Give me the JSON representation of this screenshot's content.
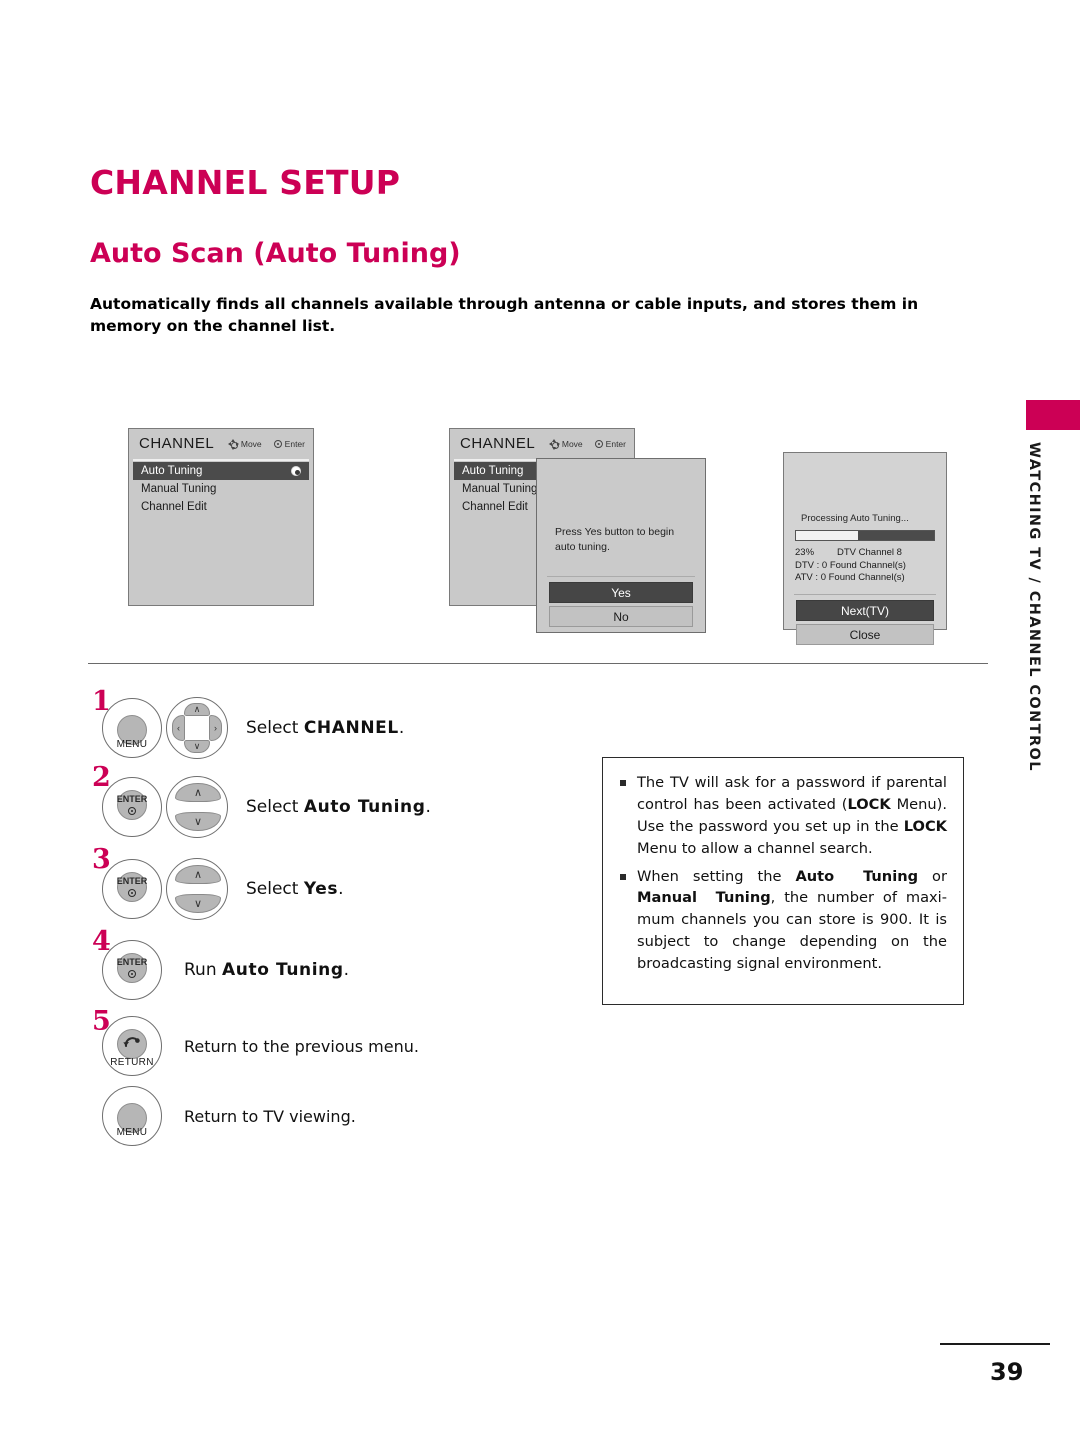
{
  "document": {
    "section_title": "CHANNEL SETUP",
    "topic_title": "Auto Scan (Auto Tuning)",
    "intro": "Automatically finds all channels available through antenna or cable inputs, and stores them in memory on the channel list.",
    "side_tab": "WATCHING TV / CHANNEL CONTROL",
    "page_number": "39",
    "accent_color": "#cc0055"
  },
  "osd_menu_1": {
    "title": "CHANNEL",
    "hint_move": "Move",
    "hint_enter": "Enter",
    "items": [
      {
        "label": "Auto Tuning",
        "selected": true,
        "radio": true
      },
      {
        "label": "Manual Tuning",
        "selected": false,
        "radio": false
      },
      {
        "label": "Channel Edit",
        "selected": false,
        "radio": false
      }
    ]
  },
  "osd_menu_2": {
    "title": "CHANNEL",
    "hint_move": "Move",
    "hint_enter": "Enter",
    "items": [
      {
        "label": "Auto Tuning",
        "selected": true
      },
      {
        "label": "Manual Tuning",
        "selected": false
      },
      {
        "label": "Channel Edit",
        "selected": false
      }
    ],
    "dialog": {
      "message_line1": "Press  Yes  button to begin",
      "message_line2": "auto tuning.",
      "yes_label": "Yes",
      "no_label": "No"
    }
  },
  "osd_progress": {
    "heading": "Processing Auto Tuning...",
    "percent_label": "23%",
    "channel_label": "DTV Channel 8",
    "dtv_found": "DTV : 0 Found Channel(s)",
    "atv_found": "ATV : 0 Found Channel(s)",
    "progress_fill_percent": 45,
    "next_label": "Next(TV)",
    "close_label": "Close"
  },
  "steps": [
    {
      "number": "1",
      "keys": [
        "MENU",
        "dpad"
      ],
      "text_prefix": "Select ",
      "text_bold": "CHANNEL",
      "text_suffix": "."
    },
    {
      "number": "2",
      "keys": [
        "ENTER",
        "updown"
      ],
      "text_prefix": "Select ",
      "text_bold": "Auto  Tuning",
      "text_suffix": "."
    },
    {
      "number": "3",
      "keys": [
        "ENTER",
        "updown"
      ],
      "text_prefix": "Select ",
      "text_bold": "Yes",
      "text_suffix": "."
    },
    {
      "number": "4",
      "keys": [
        "ENTER"
      ],
      "text_prefix": "Run ",
      "text_bold": "Auto  Tuning",
      "text_suffix": "."
    },
    {
      "number": "5",
      "keys": [
        "RETURN"
      ],
      "text_prefix": "Return to the previous menu.",
      "text_bold": "",
      "text_suffix": ""
    },
    {
      "number": "",
      "keys": [
        "MENU"
      ],
      "text_prefix": "Return to TV viewing.",
      "text_bold": "",
      "text_suffix": ""
    }
  ],
  "key_labels": {
    "menu": "MENU",
    "enter": "ENTER",
    "return": "RETURN",
    "arrow_up": "∧",
    "arrow_down": "∨",
    "arrow_left": "‹",
    "arrow_right": "›"
  },
  "note": {
    "items": [
      "The TV will ask for a password if parental control has been activated (LOCK Menu). Use the password you set up in the LOCK Menu to allow a channel search.",
      "When setting the Auto Tuning or Manual Tuning, the number of maximum channels you can store is 900. It is subject to change depending on the broadcasting signal environment."
    ]
  }
}
